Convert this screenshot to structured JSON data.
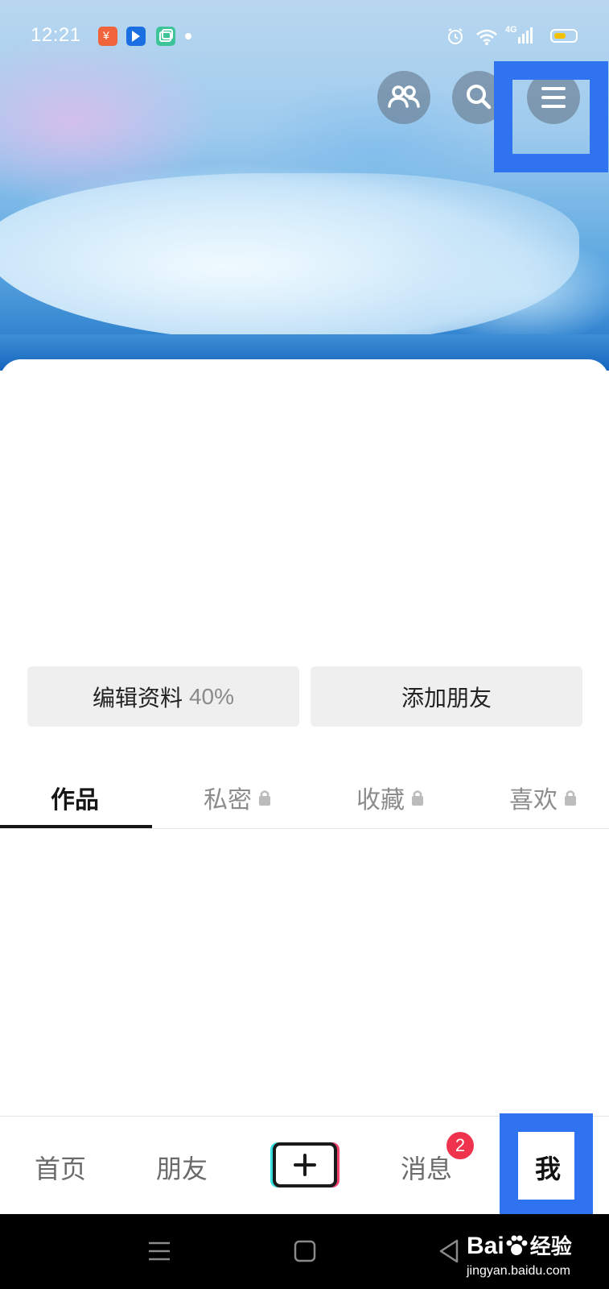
{
  "status_bar": {
    "time": "12:21",
    "network": "4G",
    "app_icons": [
      {
        "name": "app-icon-orange",
        "color": "#f0643c"
      },
      {
        "name": "app-icon-blue",
        "color": "#1b6fe0"
      },
      {
        "name": "app-icon-green",
        "color": "#3fc49a"
      }
    ]
  },
  "header": {
    "buttons": [
      "friends-icon",
      "search-icon",
      "menu-icon"
    ]
  },
  "profile": {
    "edit_label": "编辑资料",
    "edit_progress": "40%",
    "add_friend_label": "添加朋友"
  },
  "tabs": [
    {
      "label": "作品",
      "locked": false,
      "active": true
    },
    {
      "label": "私密",
      "locked": true,
      "active": false
    },
    {
      "label": "收藏",
      "locked": true,
      "active": false
    },
    {
      "label": "喜欢",
      "locked": true,
      "active": false
    }
  ],
  "bottom_nav": {
    "items": [
      {
        "label": "首页",
        "active": false
      },
      {
        "label": "朋友",
        "active": false
      },
      {
        "label": "消息",
        "active": false,
        "badge": "2"
      },
      {
        "label": "我",
        "active": true
      }
    ]
  },
  "watermark": {
    "brand_left": "Bai",
    "brand_right": "经验",
    "url": "jingyan.baidu.com"
  },
  "colors": {
    "highlight": "#2f73f0",
    "badge": "#f0334d",
    "tab_active": "#161616",
    "tab_inactive": "#8c8c8c"
  }
}
